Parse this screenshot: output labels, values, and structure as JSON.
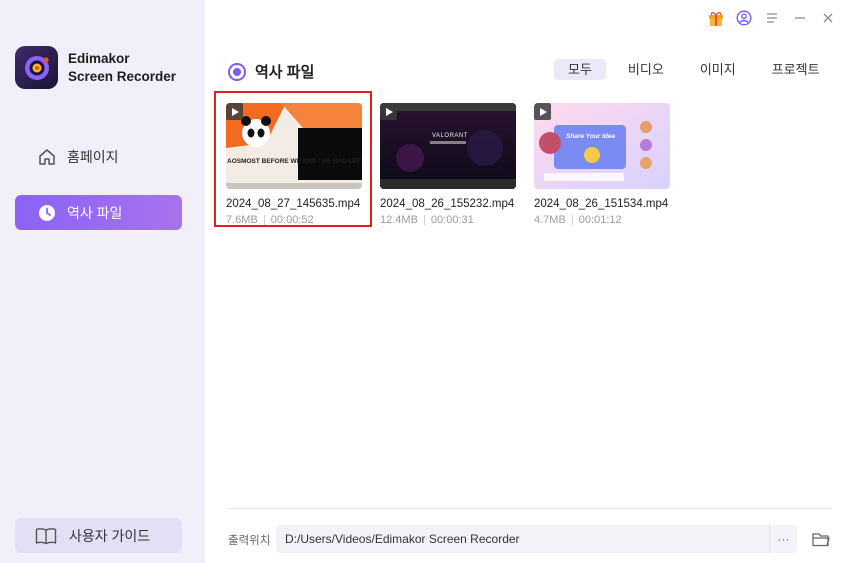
{
  "app": {
    "name_line1": "Edimakor",
    "name_line2": "Screen Recorder"
  },
  "sidebar": {
    "items": [
      {
        "label": "홈페이지",
        "icon": "home-icon"
      },
      {
        "label": "역사 파일",
        "icon": "clock-icon",
        "active": true
      }
    ],
    "guide_label": "사용자 가이드",
    "guide_icon": "book-icon"
  },
  "titlebar": {
    "icons": [
      "gift-icon",
      "account-icon",
      "menu-icon",
      "minimize-icon",
      "close-icon"
    ]
  },
  "main": {
    "title": "역사 파일",
    "filters": [
      {
        "label": "모두",
        "active": true
      },
      {
        "label": "비디오"
      },
      {
        "label": "이미지"
      },
      {
        "label": "프로젝트"
      }
    ],
    "files": [
      {
        "name": "2024_08_27_145635.mp4",
        "size": "7.6MB",
        "duration": "00:00:52",
        "selected": true,
        "thumb_text": "AOSMOST BEFORE WE KNE / VE HAD LEFT THE GROUND."
      },
      {
        "name": "2024_08_26_155232.mp4",
        "size": "12.4MB",
        "duration": "00:00:31",
        "thumb_text": "VALORANT"
      },
      {
        "name": "2024_08_26_151534.mp4",
        "size": "4.7MB",
        "duration": "00:01:12",
        "thumb_text": "Share Your Idea"
      }
    ]
  },
  "output": {
    "label": "출력위치",
    "path": "D:/Users/Videos/Edimakor Screen Recorder",
    "more_label": "···"
  },
  "colors": {
    "accent": "#8a63f6",
    "sidebar_bg": "#f1f0fa",
    "selected_border": "#e02020"
  }
}
